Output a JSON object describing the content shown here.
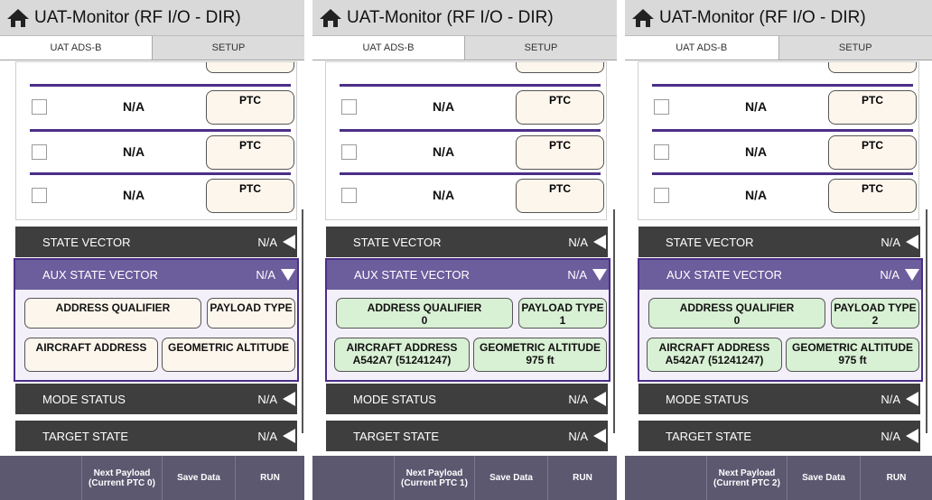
{
  "panels": [
    {
      "app_title": "UAT-Monitor (RF I/O - DIR)",
      "tabs": [
        "UAT ADS-B",
        "SETUP"
      ],
      "ptc_rows": [
        {
          "label": "N/A",
          "button": "PTC"
        },
        {
          "label": "N/A",
          "button": "PTC"
        },
        {
          "label": "N/A",
          "button": "PTC"
        }
      ],
      "sections": {
        "state_vector": {
          "label": "STATE VECTOR",
          "value": "N/A"
        },
        "aux_state_vector": {
          "label": "AUX STATE VECTOR",
          "value": "N/A"
        },
        "mode_status": {
          "label": "MODE STATUS",
          "value": "N/A"
        },
        "target_state": {
          "label": "TARGET STATE",
          "value": "N/A"
        }
      },
      "aux_fields": {
        "address_qualifier": {
          "label": "ADDRESS QUALIFIER",
          "value": ""
        },
        "payload_type": {
          "label": "PAYLOAD TYPE",
          "value": ""
        },
        "aircraft_address": {
          "label": "AIRCRAFT ADDRESS",
          "value": ""
        },
        "geometric_altitude": {
          "label": "GEOMETRIC ALTITUDE",
          "value": ""
        }
      },
      "footer": {
        "next_payload_line1": "Next Payload",
        "next_payload_line2": "(Current PTC 0)",
        "save_data": "Save Data",
        "run": "RUN"
      }
    },
    {
      "app_title": "UAT-Monitor (RF I/O - DIR)",
      "tabs": [
        "UAT ADS-B",
        "SETUP"
      ],
      "ptc_rows": [
        {
          "label": "N/A",
          "button": "PTC"
        },
        {
          "label": "N/A",
          "button": "PTC"
        },
        {
          "label": "N/A",
          "button": "PTC"
        }
      ],
      "sections": {
        "state_vector": {
          "label": "STATE VECTOR",
          "value": "N/A"
        },
        "aux_state_vector": {
          "label": "AUX STATE VECTOR",
          "value": "N/A"
        },
        "mode_status": {
          "label": "MODE STATUS",
          "value": "N/A"
        },
        "target_state": {
          "label": "TARGET STATE",
          "value": "N/A"
        }
      },
      "aux_fields": {
        "address_qualifier": {
          "label": "ADDRESS QUALIFIER",
          "value": "0"
        },
        "payload_type": {
          "label": "PAYLOAD TYPE",
          "value": "1"
        },
        "aircraft_address": {
          "label": "AIRCRAFT ADDRESS",
          "value": "A542A7 (51241247)"
        },
        "geometric_altitude": {
          "label": "GEOMETRIC ALTITUDE",
          "value": "975 ft"
        }
      },
      "footer": {
        "next_payload_line1": "Next Payload",
        "next_payload_line2": "(Current PTC 1)",
        "save_data": "Save Data",
        "run": "RUN"
      }
    },
    {
      "app_title": "UAT-Monitor (RF I/O - DIR)",
      "tabs": [
        "UAT ADS-B",
        "SETUP"
      ],
      "ptc_rows": [
        {
          "label": "N/A",
          "button": "PTC"
        },
        {
          "label": "N/A",
          "button": "PTC"
        },
        {
          "label": "N/A",
          "button": "PTC"
        }
      ],
      "sections": {
        "state_vector": {
          "label": "STATE VECTOR",
          "value": "N/A"
        },
        "aux_state_vector": {
          "label": "AUX STATE VECTOR",
          "value": "N/A"
        },
        "mode_status": {
          "label": "MODE STATUS",
          "value": "N/A"
        },
        "target_state": {
          "label": "TARGET STATE",
          "value": "N/A"
        }
      },
      "aux_fields": {
        "address_qualifier": {
          "label": "ADDRESS QUALIFIER",
          "value": "0"
        },
        "payload_type": {
          "label": "PAYLOAD TYPE",
          "value": "2"
        },
        "aircraft_address": {
          "label": "AIRCRAFT ADDRESS",
          "value": "A542A7 (51241247)"
        },
        "geometric_altitude": {
          "label": "GEOMETRIC ALTITUDE",
          "value": "975 ft"
        }
      },
      "footer": {
        "next_payload_line1": "Next Payload",
        "next_payload_line2": "(Current PTC 2)",
        "save_data": "Save Data",
        "run": "RUN"
      }
    }
  ],
  "colors": {
    "header_bg": "#d9d9d9",
    "accent_purple": "#4b2f88",
    "aux_header": "#6c5d9d",
    "section_bar": "#3e3e3e",
    "footer_bg": "#5b5870",
    "field_empty": "#fdf6ec",
    "field_filled": "#d8f0d4"
  },
  "icons": [
    "home-icon",
    "collapse-left-icon",
    "expand-down-icon",
    "checkbox"
  ]
}
